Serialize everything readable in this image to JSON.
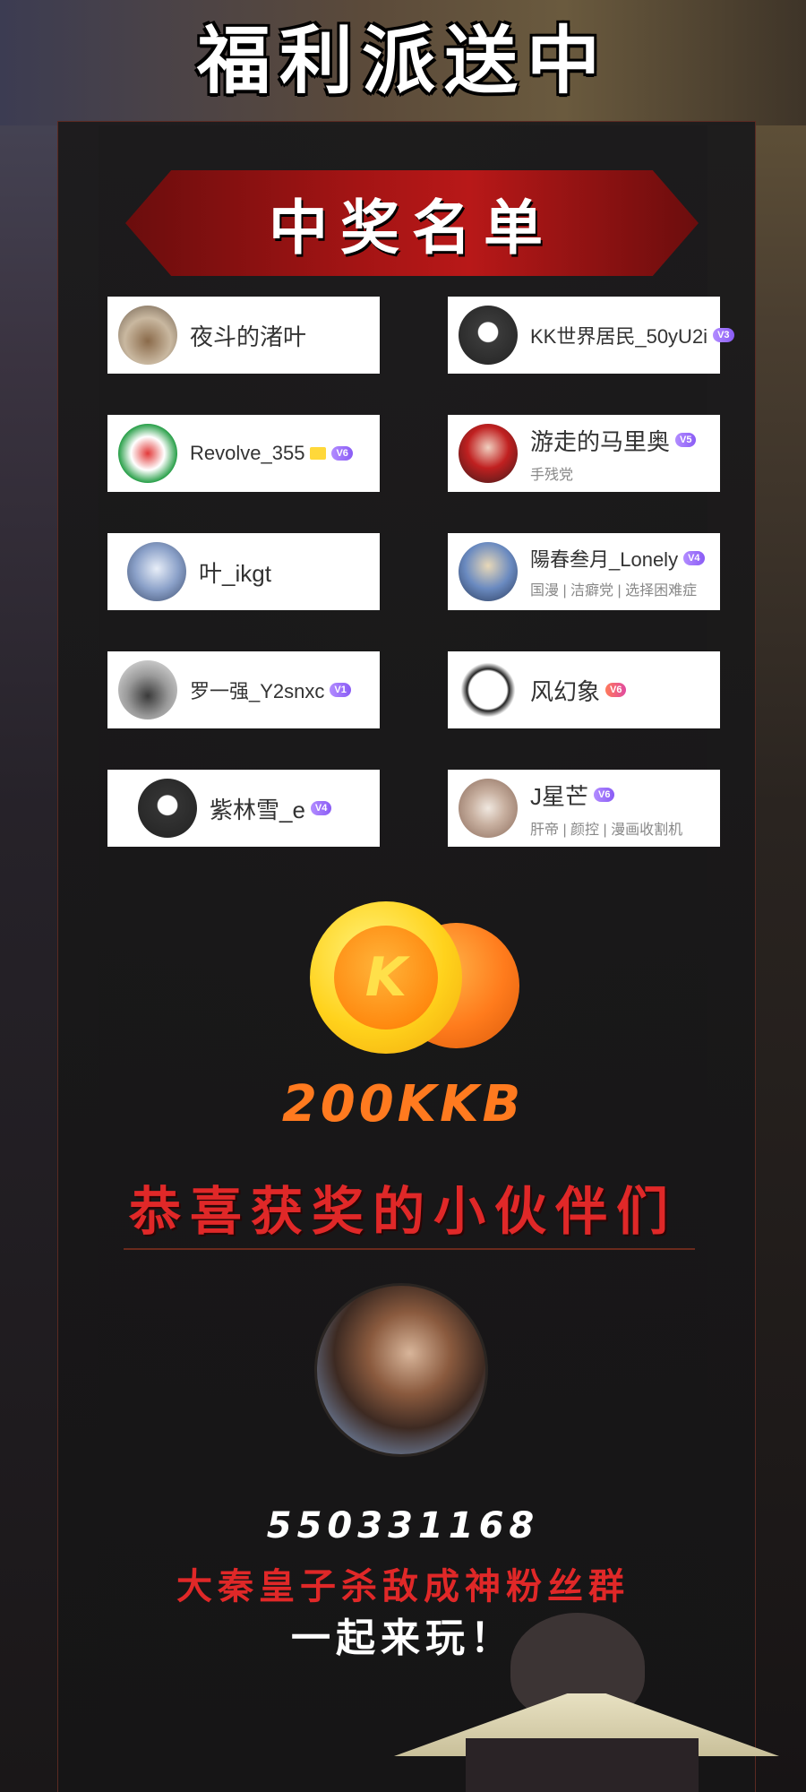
{
  "header": {
    "title": "福利派送中"
  },
  "banner": {
    "title": "中奖名单"
  },
  "winners": [
    {
      "name": "夜斗的渚叶",
      "badge": "",
      "subtitle": ""
    },
    {
      "name": "KK世界居民_50yU2i",
      "badge": "V3",
      "subtitle": ""
    },
    {
      "name": "Revolve_355",
      "badge": "V6",
      "subtitle": ""
    },
    {
      "name": "游走的马里奥",
      "badge": "V5",
      "subtitle": "手残党"
    },
    {
      "name": "叶_ikgt",
      "badge": "",
      "subtitle": ""
    },
    {
      "name": "陽春叁月_Lonely",
      "badge": "V4",
      "subtitle": "国漫 | 洁癖党 | 选择困难症"
    },
    {
      "name": "罗一强_Y2snxc",
      "badge": "V1",
      "subtitle": ""
    },
    {
      "name": "风幻象",
      "badge": "V6",
      "subtitle": ""
    },
    {
      "name": "紫林雪_e",
      "badge": "V4",
      "subtitle": ""
    },
    {
      "name": "J星芒",
      "badge": "V6",
      "subtitle": "肝帝 | 颜控 | 漫画收割机"
    }
  ],
  "prize": {
    "coin_letter": "K",
    "amount": "200KKB"
  },
  "congrats": {
    "text": "恭喜获奖的小伙伴们"
  },
  "group": {
    "number": "550331168",
    "name": "大秦皇子杀敌成神粉丝群",
    "cta": "一起来玩！"
  },
  "colors": {
    "banner_red": "#b81818",
    "prize_orange": "#ff7a1f",
    "congrats_red": "#e02828",
    "vip_purple": "#8a5cf5",
    "coin_yellow": "#ffd21c"
  }
}
